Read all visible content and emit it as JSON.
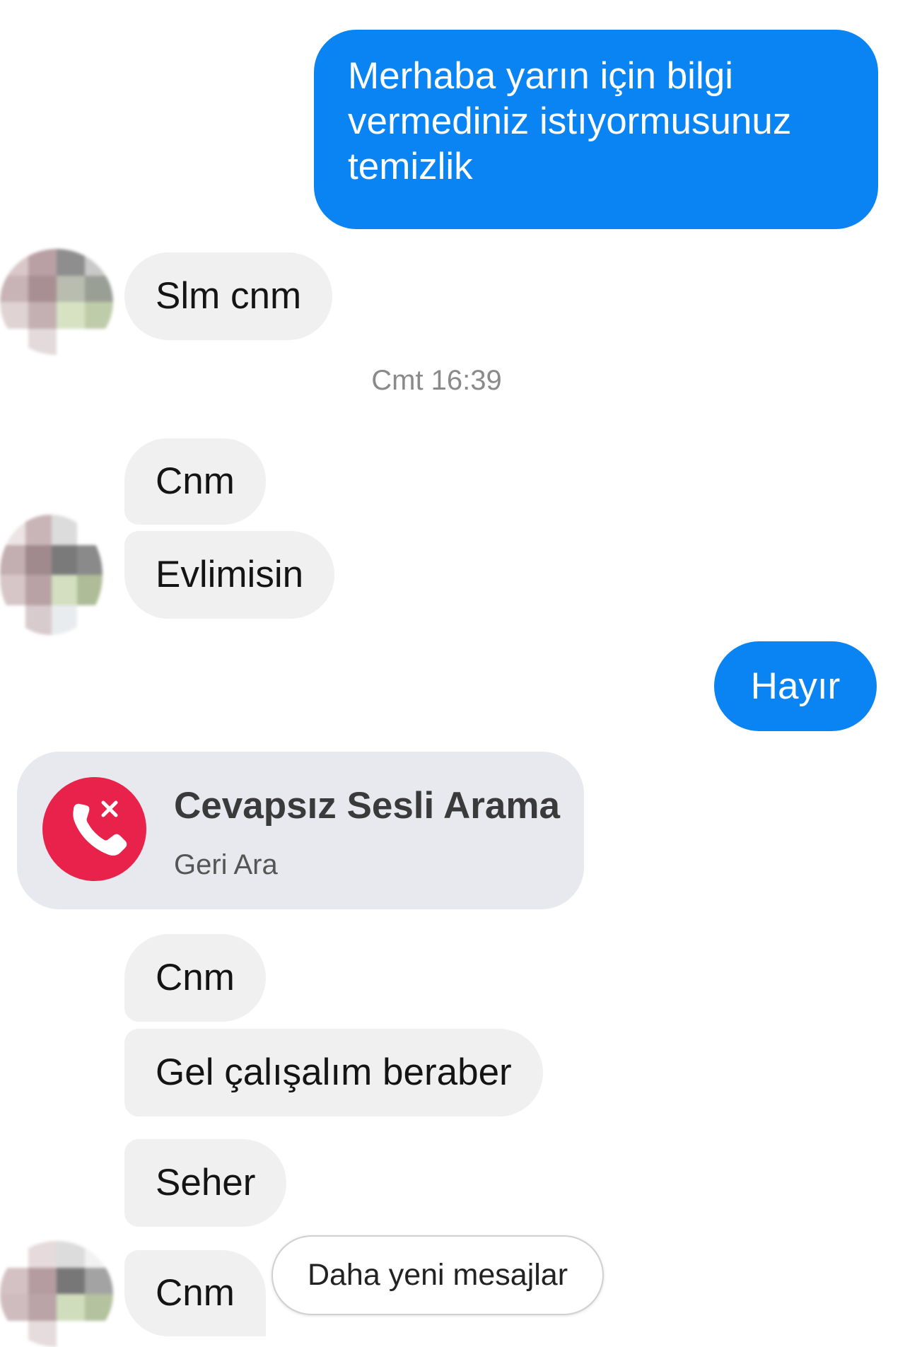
{
  "messages": {
    "sent_1": "Merhaba yarın için bilgi vermediniz istıyormusunuz temizlik",
    "recv_1": "Slm cnm",
    "timestamp": "Cmt 16:39",
    "recv_2": "Cnm",
    "recv_3": "Evlimisin",
    "sent_2": "Hayır",
    "recv_4": "Cnm",
    "recv_5": "Gel çalışalım beraber",
    "recv_6": "Seher",
    "recv_7": "Cnm"
  },
  "missed_call": {
    "title": "Cevapsız Sesli Arama",
    "action": "Geri Ara",
    "icon": "missed-call-icon",
    "color": "#e8224a"
  },
  "newer_messages_label": "Daha yeni mesajlar",
  "colors": {
    "sent_bubble": "#0b84f3",
    "received_bubble": "#f0f0f0"
  }
}
